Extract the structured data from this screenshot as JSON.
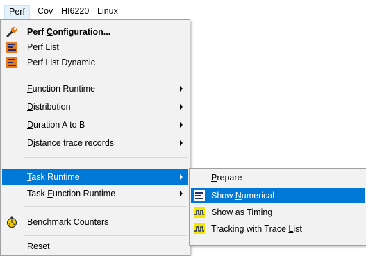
{
  "menubar": {
    "items": [
      "Perf",
      "Cov",
      "HI6220",
      "Linux"
    ]
  },
  "perf_menu": {
    "perf_configuration": {
      "pre": "Perf ",
      "u": "C",
      "post": "onfiguration..."
    },
    "perf_list": {
      "pre": "Perf ",
      "u": "L",
      "post": "ist"
    },
    "perf_list_dynamic": {
      "pre": "Perf List Dynamic",
      "u": "",
      "post": ""
    },
    "function_runtime": {
      "pre": "",
      "u": "F",
      "post": "unction Runtime"
    },
    "distribution": {
      "pre": "",
      "u": "D",
      "post": "istribution"
    },
    "duration": {
      "pre": "",
      "u": "D",
      "post": "uration A to B"
    },
    "distance": {
      "pre": "D",
      "u": "i",
      "post": "stance trace records"
    },
    "task_runtime": {
      "pre": "",
      "u": "T",
      "post": "ask Runtime"
    },
    "task_function_runtime": {
      "pre": "Task ",
      "u": "F",
      "post": "unction Runtime"
    },
    "benchmark_counters": {
      "pre": "Benchmark Counters",
      "u": "",
      "post": ""
    },
    "reset": {
      "pre": "",
      "u": "R",
      "post": "eset"
    }
  },
  "task_runtime_submenu": {
    "prepare": {
      "pre": "",
      "u": "P",
      "post": "repare"
    },
    "show_numerical": {
      "pre": "Show ",
      "u": "N",
      "post": "umerical"
    },
    "show_as_timing": {
      "pre": "Show as ",
      "u": "T",
      "post": "iming"
    },
    "tracking": {
      "pre": "Tracking with Trace ",
      "u": "L",
      "post": "ist"
    }
  },
  "icons": {
    "perf_configuration": "wrench-icon",
    "perf_list": "list-bars-icon",
    "perf_list_dynamic": "list-bars-icon",
    "benchmark_counters": "stopwatch-icon",
    "show_numerical": "list-bars-icon",
    "show_as_timing": "timing-wave-icon",
    "tracking": "timing-wave-icon"
  },
  "colors": {
    "highlight": "#0078d7",
    "menu_background": "#f2f2f2",
    "icon_orange": "#e87a1c",
    "icon_navy": "#1a2a6c",
    "timing_yellow": "#f5e600"
  }
}
